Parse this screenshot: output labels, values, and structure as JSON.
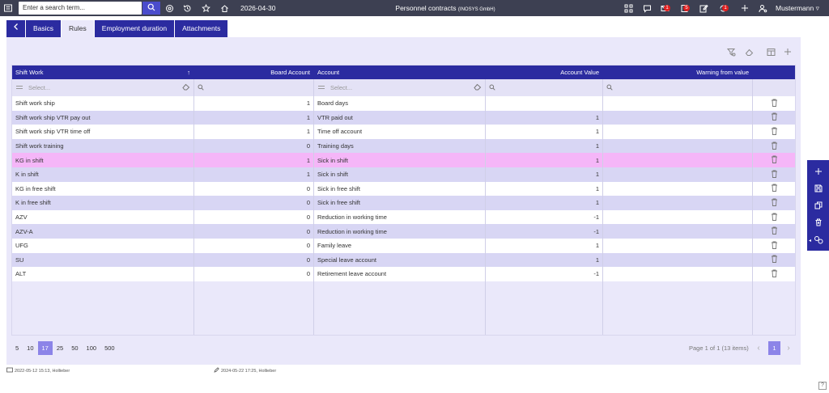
{
  "topbar": {
    "search_placeholder": "Enter a search term...",
    "date": "2026-04-30",
    "title": "Personnel contracts",
    "company": "(INOSYS GmbH)",
    "mail_count": "1",
    "alert_count": "5",
    "task_count": "1",
    "user": "Mustermann"
  },
  "tabs": [
    {
      "label": "Basics"
    },
    {
      "label": "Rules"
    },
    {
      "label": "Employment duration"
    },
    {
      "label": "Attachments"
    }
  ],
  "grid": {
    "headers": {
      "shift_work": "Shift Work",
      "board_account": "Board Account",
      "account": "Account",
      "account_value": "Account Value",
      "warning_from_value": "Warning from value"
    },
    "filter_placeholder": "Select...",
    "rows": [
      {
        "shift": "Shift work ship",
        "board": "1",
        "account": "Board days",
        "value": "",
        "warning": ""
      },
      {
        "shift": "Shift work ship VTR pay out",
        "board": "1",
        "account": "VTR paid out",
        "value": "1",
        "warning": ""
      },
      {
        "shift": "Shift work ship VTR time off",
        "board": "1",
        "account": "Time off account",
        "value": "1",
        "warning": ""
      },
      {
        "shift": "Shift work training",
        "board": "0",
        "account": "Training days",
        "value": "1",
        "warning": ""
      },
      {
        "shift": "KG in shift",
        "board": "1",
        "account": "Sick in shift",
        "value": "1",
        "warning": ""
      },
      {
        "shift": "K in shift",
        "board": "1",
        "account": "Sick in shift",
        "value": "1",
        "warning": ""
      },
      {
        "shift": "KG in free shift",
        "board": "0",
        "account": "Sick in free shift",
        "value": "1",
        "warning": ""
      },
      {
        "shift": "K in free shift",
        "board": "0",
        "account": "Sick in free shift",
        "value": "1",
        "warning": ""
      },
      {
        "shift": "AZV",
        "board": "0",
        "account": "Reduction in working time",
        "value": "-1",
        "warning": ""
      },
      {
        "shift": "AZV-A",
        "board": "0",
        "account": "Reduction in working time",
        "value": "-1",
        "warning": ""
      },
      {
        "shift": "UFG",
        "board": "0",
        "account": "Family leave",
        "value": "1",
        "warning": ""
      },
      {
        "shift": "SU",
        "board": "0",
        "account": "Special leave account",
        "value": "1",
        "warning": ""
      },
      {
        "shift": "ALT",
        "board": "0",
        "account": "Retirement leave account",
        "value": "-1",
        "warning": ""
      }
    ]
  },
  "pager": {
    "sizes": [
      "5",
      "10",
      "17",
      "25",
      "50",
      "100",
      "500"
    ],
    "active_size": "17",
    "info": "Page 1 of 1 (13 items)",
    "current_page": "1"
  },
  "footer": {
    "created": "2022-05-12 15:13, Hollieber",
    "modified": "2024-05-22 17:25, Hollieber"
  },
  "help": "?"
}
